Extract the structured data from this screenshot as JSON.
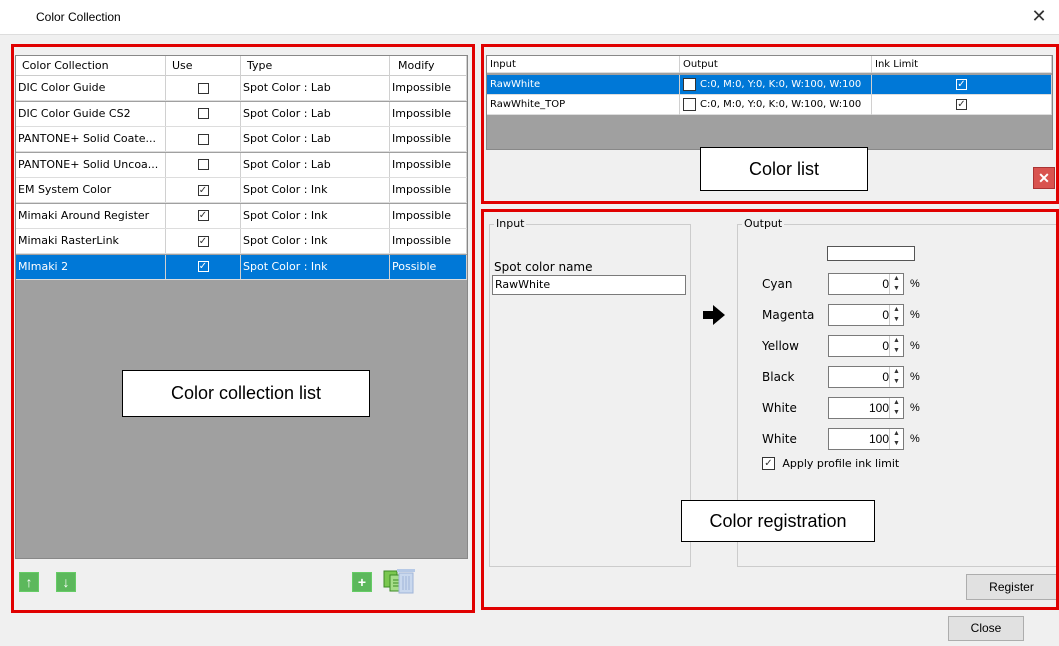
{
  "window": {
    "title": "Color Collection",
    "close_glyph": "✕"
  },
  "collection_grid": {
    "headers": [
      "Color Collection",
      "Use",
      "Type",
      "Modify"
    ],
    "rows": [
      {
        "name": "DIC Color Guide",
        "use": false,
        "type": "Spot Color : Lab",
        "modify": "Impossible"
      },
      {
        "name": "DIC Color Guide CS2",
        "use": false,
        "type": "Spot Color : Lab",
        "modify": "Impossible"
      },
      {
        "name": "PANTONE+ Solid Coate...",
        "use": false,
        "type": "Spot Color : Lab",
        "modify": "Impossible"
      },
      {
        "name": "PANTONE+ Solid Uncoa...",
        "use": false,
        "type": "Spot Color : Lab",
        "modify": "Impossible"
      },
      {
        "name": "EM System Color",
        "use": true,
        "type": "Spot Color : Ink",
        "modify": "Impossible"
      },
      {
        "name": "Mimaki Around Register",
        "use": true,
        "type": "Spot Color : Ink",
        "modify": "Impossible"
      },
      {
        "name": "Mimaki RasterLink",
        "use": true,
        "type": "Spot Color : Ink",
        "modify": "Impossible"
      },
      {
        "name": "MImaki 2",
        "use": true,
        "type": "Spot Color : Ink",
        "modify": "Possible",
        "selected": true
      }
    ]
  },
  "color_list_grid": {
    "headers": [
      "Input",
      "Output",
      "Ink Limit"
    ],
    "rows": [
      {
        "input": "RawWhite",
        "output": "C:0, M:0, Y:0, K:0, W:100, W:100",
        "ink_limit": true,
        "selected": true
      },
      {
        "input": "RawWhite_TOP",
        "output": "C:0, M:0, Y:0, K:0, W:100, W:100",
        "ink_limit": true
      }
    ]
  },
  "annotations": {
    "collection": "Color collection list",
    "color_list": "Color list",
    "registration": "Color registration"
  },
  "registration": {
    "input_group": "Input",
    "output_group": "Output",
    "spot_name_label": "Spot color name",
    "spot_name_value": "RawWhite",
    "channels": [
      {
        "label": "Cyan",
        "value": "0",
        "unit": "%"
      },
      {
        "label": "Magenta",
        "value": "0",
        "unit": "%"
      },
      {
        "label": "Yellow",
        "value": "0",
        "unit": "%"
      },
      {
        "label": "Black",
        "value": "0",
        "unit": "%"
      },
      {
        "label": "White",
        "value": "100",
        "unit": "%"
      },
      {
        "label": "White",
        "value": "100",
        "unit": "%"
      }
    ],
    "apply_limit_label": "Apply profile ink limit",
    "apply_limit_checked": true,
    "register_label": "Register"
  },
  "footer": {
    "close_label": "Close"
  },
  "colors": {
    "selection": "#0078d7",
    "annotation_border": "#e00000",
    "grid_empty": "#a0a0a0",
    "icon_green": "#5cb85c",
    "delete_red": "#d9534f"
  }
}
